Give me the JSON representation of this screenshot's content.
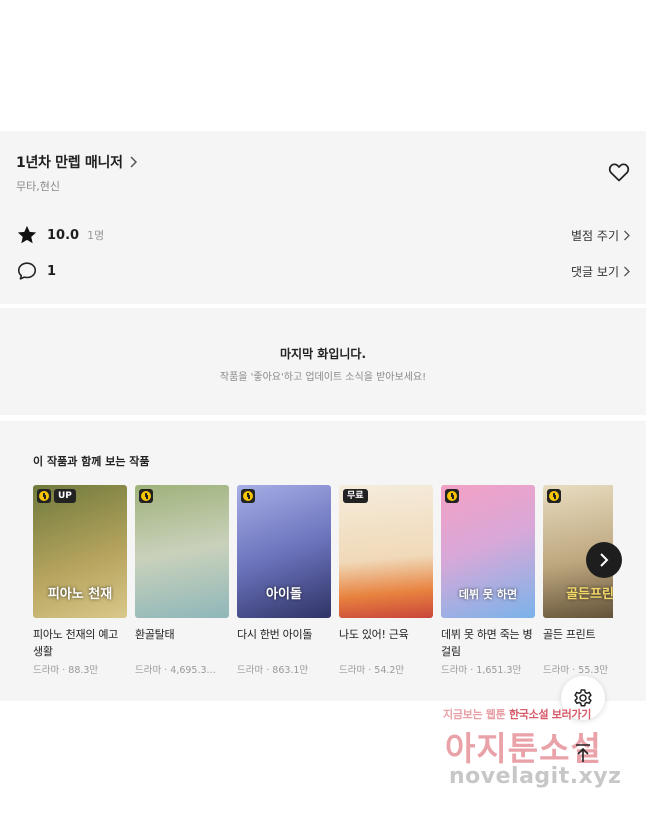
{
  "work": {
    "title": "1년차 만렙 매니저",
    "genre": "무타,현신",
    "rating": "10.0",
    "rating_count": "1명",
    "rate_action": "별점 주기",
    "comments": "1",
    "comments_action": "댓글 보기"
  },
  "last_episode": {
    "title": "마지막 화입니다.",
    "subtitle": "작품을 '좋아요'하고 업데이트 소식을 받아보세요!"
  },
  "recommendations": {
    "heading": "이 작품과 함께 보는 작품",
    "items": [
      {
        "title": "피아노 천재의 예고 생활",
        "meta": "드라마 · 88.3만",
        "badge": "UP",
        "art_text": "피아노 천재",
        "color_top": "#6f7a3c",
        "color_bottom": "#c9b56a"
      },
      {
        "title": "환골탈태",
        "meta": "드라마 · 4,695.3...",
        "badge": "",
        "art_text": "",
        "color_top": "#8aa06a",
        "color_bottom": "#cfd6c2"
      },
      {
        "title": "다시 한번 아이돌",
        "meta": "드라마 · 863.1만",
        "badge": "",
        "art_text": "아이돌",
        "color_top": "#7b86c9",
        "color_bottom": "#3c3f78"
      },
      {
        "title": "나도 있어! 근육",
        "meta": "드라마 · 54.2만",
        "badge": "무료",
        "art_text": "",
        "color_top": "#f3e6d2",
        "color_bottom": "#e27c3c"
      },
      {
        "title": "데뷔 못 하면 죽는 병 걸림",
        "meta": "드라마 · 1,651.3만",
        "badge": "",
        "art_text": "데뷔 못 하면",
        "color_top": "#e88fb5",
        "color_bottom": "#6aa9e6"
      },
      {
        "title": "골든 프린트",
        "meta": "드라마 · 55.3만",
        "badge": "",
        "art_text": "골든프린",
        "color_top": "#d7c8a8",
        "color_bottom": "#6b5a3e"
      }
    ]
  },
  "watermark": {
    "line1_a": "지금보는 웹툰",
    "line1_b": "한국소설",
    "line1_c": "보러가기",
    "brand": "아지툰소설",
    "url": "novelagit.xyz"
  },
  "colors": {
    "panel_bg": "#f5f5f5",
    "clock_badge": "#f6c400",
    "watermark": "#eaa2a9"
  },
  "icons": [
    "chevron-right-icon",
    "heart-icon",
    "star-icon",
    "comment-icon",
    "clock-icon",
    "settings-icon",
    "arrow-up-icon"
  ]
}
